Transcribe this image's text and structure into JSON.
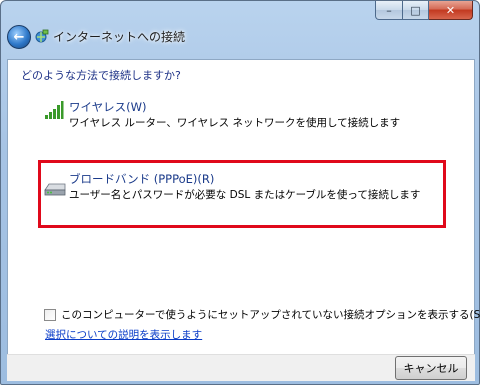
{
  "window": {
    "title": "インターネットへの接続",
    "caption_min": "–",
    "caption_max": "□",
    "caption_close": "✕",
    "back_glyph": "←"
  },
  "main": {
    "question": "どのような方法で接続しますか?",
    "options": [
      {
        "title": "ワイヤレス(W)",
        "description": "ワイヤレス ルーター、ワイヤレス ネットワークを使用して接続します",
        "icon": "wireless-signal-icon",
        "highlighted": false
      },
      {
        "title": "ブロードバンド (PPPoE)(R)",
        "description": "ユーザー名とパスワードが必要な DSL またはケーブルを使って接続します",
        "icon": "broadband-modem-icon",
        "highlighted": true,
        "highlight_color": "#e0091b"
      }
    ],
    "show_unsetup_checkbox": {
      "label": "このコンピューターで使うようにセットアップされていない接続オプションを表示する(S)",
      "checked": false
    },
    "help_link": "選択についての説明を表示します"
  },
  "footer": {
    "cancel_label": "キャンセル"
  },
  "colors": {
    "accent_link": "#0a3cc8",
    "question_text": "#1e3287",
    "highlight_border": "#e0091b"
  }
}
